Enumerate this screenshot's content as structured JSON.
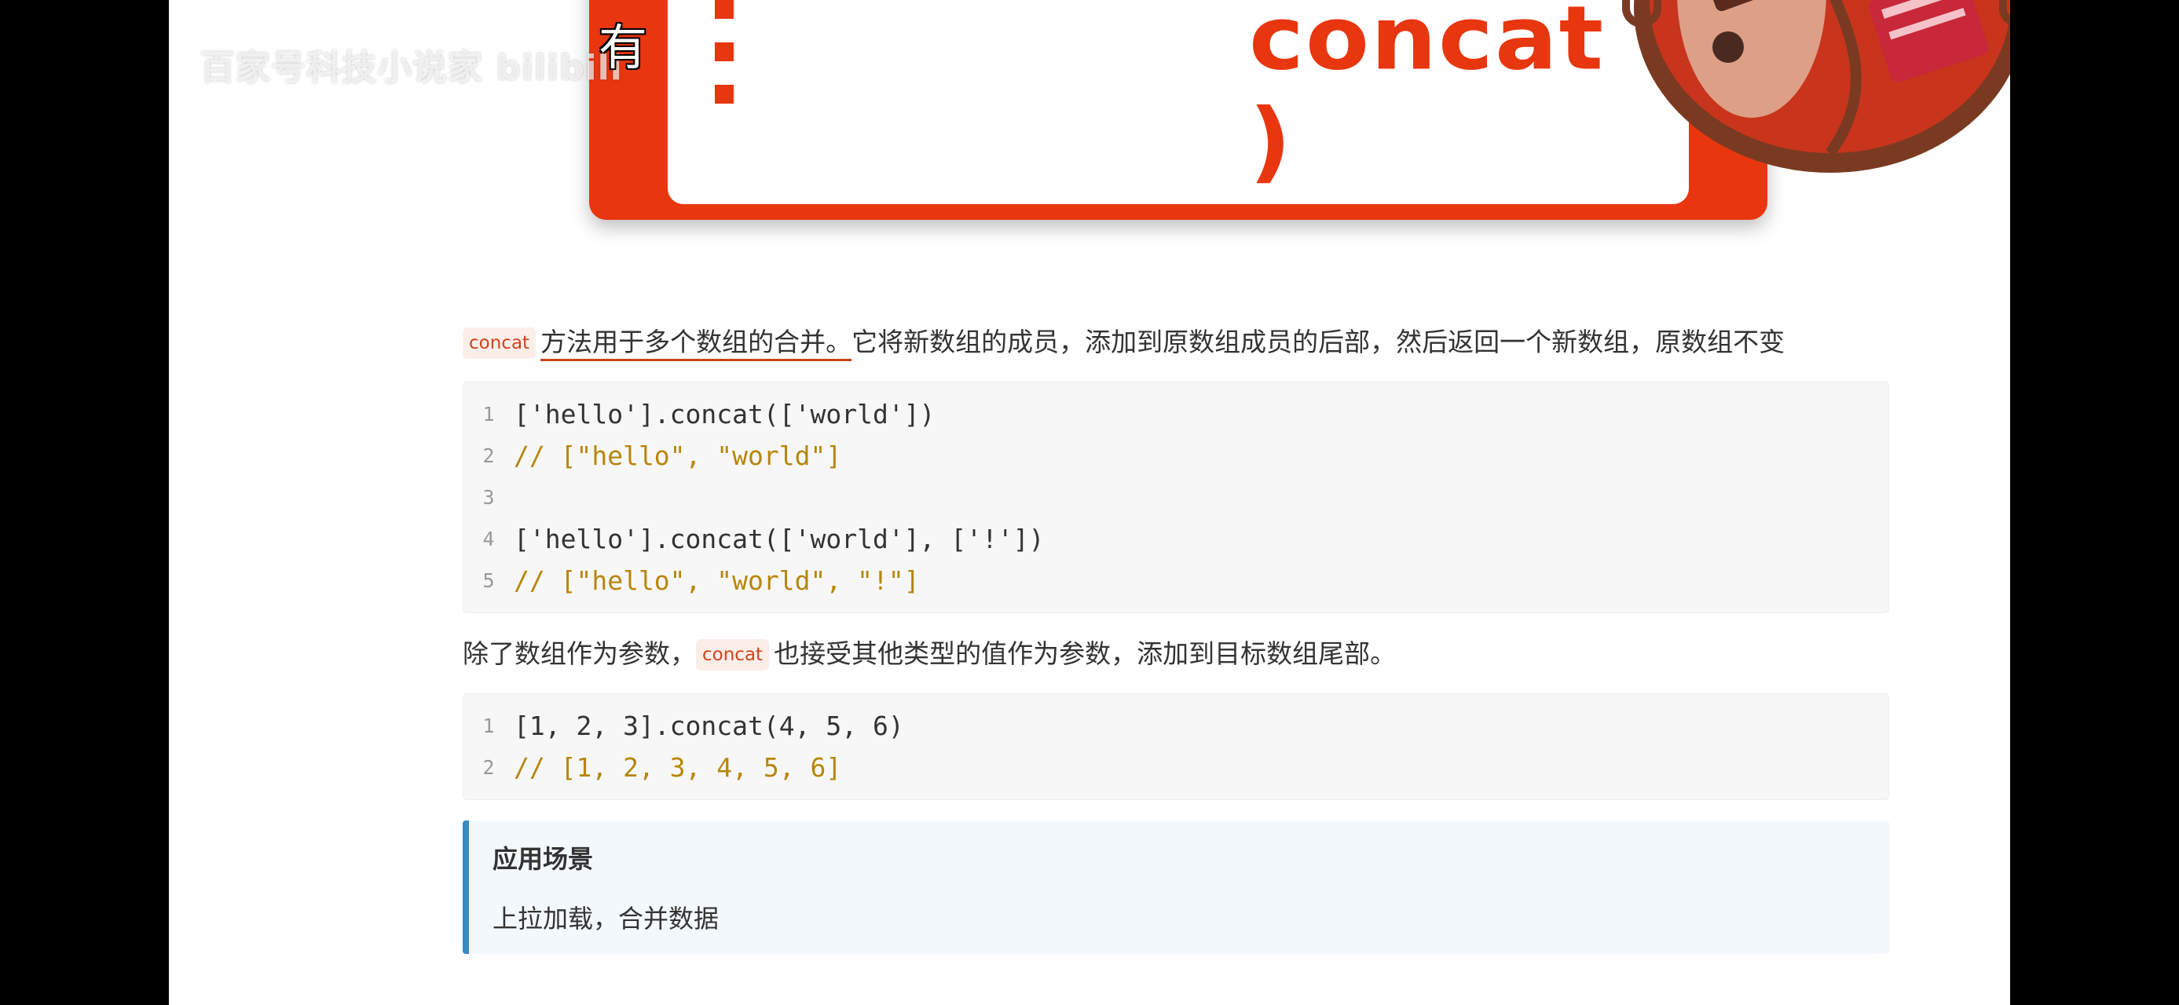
{
  "overlay": {
    "watermark": "百家号科技小说家 bilibili",
    "subtitle_char": "有"
  },
  "banner": {
    "title": "concat ( )",
    "accent_color": "#e8360f",
    "illustration": "hotpot-illustration"
  },
  "intro": {
    "code_tag": "concat",
    "underlined_text": "方法用于多个数组的合并。",
    "rest_text": "它将新数组的成员，添加到原数组成员的后部，然后返回一个新数组，原数组不变"
  },
  "code_block_1": {
    "lines": [
      {
        "num": "1",
        "text": "['hello'].concat(['world'])"
      },
      {
        "num": "2",
        "text": "// [\"hello\", \"world\"]"
      },
      {
        "num": "3",
        "text": ""
      },
      {
        "num": "4",
        "text": "['hello'].concat(['world'], ['!'])"
      },
      {
        "num": "5",
        "text": "// [\"hello\", \"world\", \"!\"]"
      }
    ]
  },
  "para2": {
    "before": "除了数组作为参数，",
    "code_tag": "concat",
    "after": "也接受其他类型的值作为参数，添加到目标数组尾部。"
  },
  "code_block_2": {
    "lines": [
      {
        "num": "1",
        "text": "[1, 2, 3].concat(4, 5, 6)"
      },
      {
        "num": "2",
        "text": "// [1, 2, 3, 4, 5, 6]"
      }
    ]
  },
  "callout": {
    "title": "应用场景",
    "body": "上拉加载，合并数据",
    "border_color": "#3b88c3"
  }
}
